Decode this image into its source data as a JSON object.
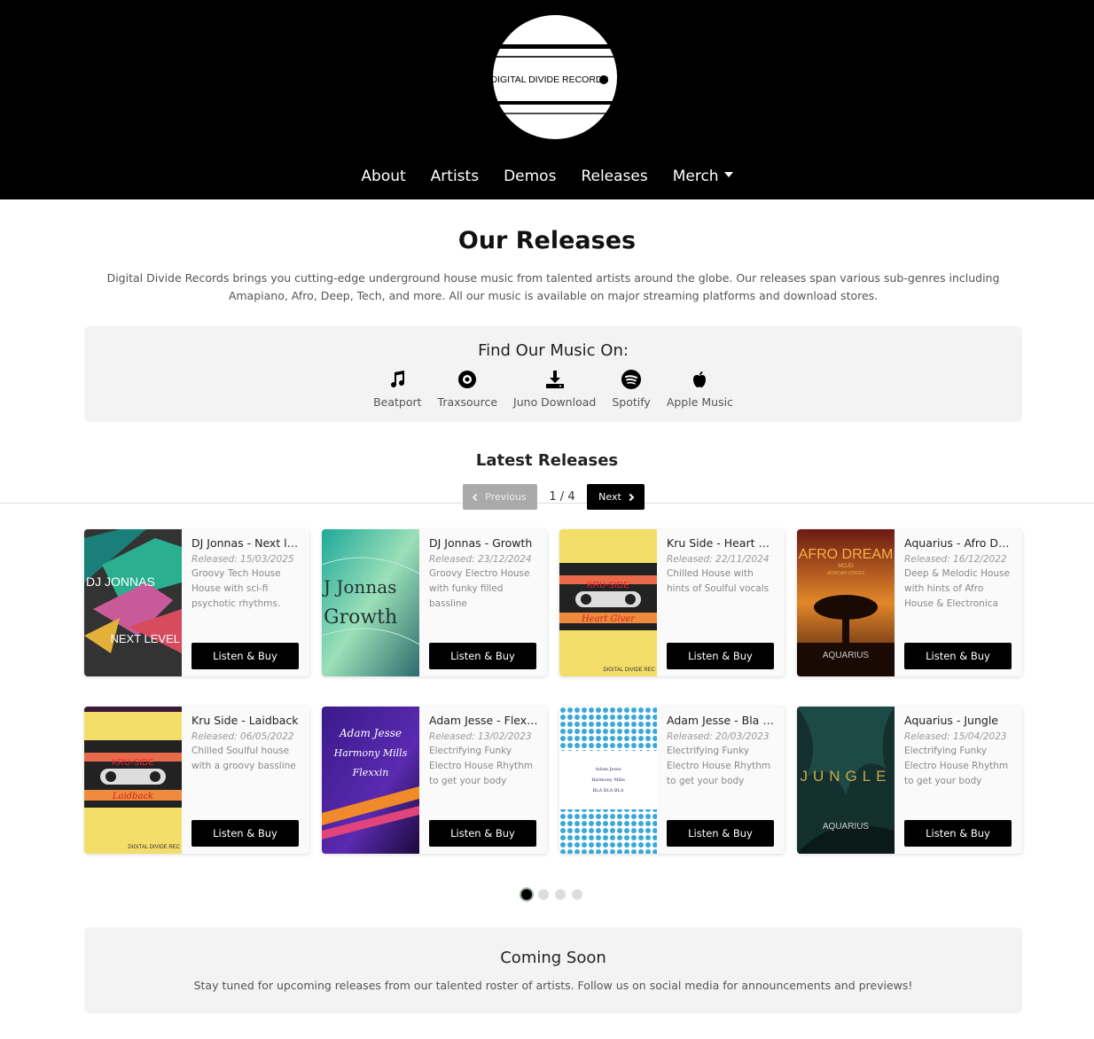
{
  "header": {
    "logo_text": "DIGITAL DIVIDE RECORDS",
    "nav": [
      {
        "label": "About"
      },
      {
        "label": "Artists"
      },
      {
        "label": "Demos"
      },
      {
        "label": "Releases"
      },
      {
        "label": "Merch"
      }
    ]
  },
  "intro": {
    "title": "Our Releases",
    "text": "Digital Divide Records brings you cutting-edge underground house music from talented artists around the globe. Our releases span various sub-genres including Amapiano, Afro, Deep, Tech, and more. All our music is available on major streaming platforms and download stores."
  },
  "find": {
    "title": "Find Our Music On:",
    "platforms": [
      {
        "label": "Beatport",
        "icon": "music-note-icon"
      },
      {
        "label": "Traxsource",
        "icon": "record-icon"
      },
      {
        "label": "Juno Download",
        "icon": "download-icon"
      },
      {
        "label": "Spotify",
        "icon": "spotify-icon"
      },
      {
        "label": "Apple Music",
        "icon": "apple-icon"
      }
    ]
  },
  "latest": {
    "title": "Latest Releases",
    "prev_label": "Previous",
    "next_label": "Next",
    "page_indicator": "1 / 4",
    "current_page": 1,
    "total_pages": 4,
    "listen_label": "Listen & Buy",
    "releases": [
      {
        "title": "DJ Jonnas - Next level",
        "date": "Released: 15/03/2025",
        "desc": "Groovy Tech House House with sci-fi psychotic rhythms.",
        "cover_text": [
          "DJ JONNAS",
          "NEXT LEVEL"
        ]
      },
      {
        "title": "DJ Jonnas - Growth",
        "date": "Released: 23/12/2024",
        "desc": "Groovy Electro House with funky filled bassline",
        "cover_text": [
          "J Jonnas",
          "Growth"
        ]
      },
      {
        "title": "Kru Side - Heart Giver",
        "date": "Released: 22/11/2024",
        "desc": "Chilled House with hints of Soulful vocals",
        "cover_text": [
          "KRU-SIDE",
          "Heart Giver",
          "DIGITAL DIVIDE REC"
        ]
      },
      {
        "title": "Aquarius - Afro Dream",
        "date": "Released: 16/12/2022",
        "desc": "Deep & Melodic House with hints of Afro House & Electronica",
        "cover_text": [
          "AFRO DREAM",
          "MOJO",
          "AFRICAN VOICES",
          "AQUARIUS"
        ]
      },
      {
        "title": "Kru Side - Laidback",
        "date": "Released: 06/05/2022",
        "desc": "Chilled Soulful house with a groovy bassline",
        "cover_text": [
          "KRU-SIDE",
          "Laidback",
          "DIGITAL DIVIDE REC"
        ]
      },
      {
        "title": "Adam Jesse - Flexxin",
        "date": "Released: 13/02/2023",
        "desc": "Electrifying Funky Electro House Rhythm to get your body moving",
        "cover_text": [
          "Adam Jesse",
          "Harmony Mills",
          "Flexxin"
        ]
      },
      {
        "title": "Adam Jesse - Bla Bla Bla",
        "date": "Released: 20/03/2023",
        "desc": "Electrifying Funky Electro House Rhythm to get your body moving",
        "cover_text": [
          "Adam Jesse",
          "Harmony Mills",
          "BLA BLA BLA"
        ]
      },
      {
        "title": "Aquarius - Jungle",
        "date": "Released: 15/04/2023",
        "desc": "Electrifying Funky Electro House Rhythm to get your body moving",
        "cover_text": [
          "JUNGLE",
          "AQUARIUS"
        ]
      }
    ]
  },
  "soon": {
    "title": "Coming Soon",
    "text": "Stay tuned for upcoming releases from our talented roster of artists. Follow us on social media for announcements and previews!"
  }
}
